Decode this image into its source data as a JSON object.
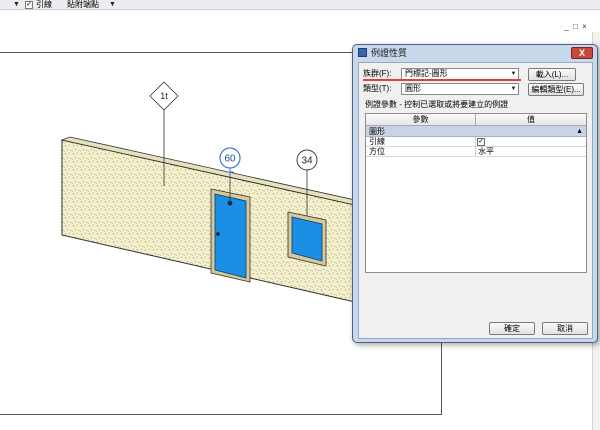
{
  "option_bar": {
    "leader_label": "引線",
    "leader_checked": true,
    "attachment_value": "貼附端點"
  },
  "view_tags": {
    "section_tag": "1t",
    "door_tag": "60",
    "window_tag": "34"
  },
  "colors": {
    "door_fill": "#1a8fe3",
    "window_fill": "#1a8fe3",
    "wall_fill": "#f4f0cc",
    "accent_red": "#d7453a"
  },
  "dialog": {
    "title": "例證性質",
    "close_glyph": "X",
    "family_label": "族群(F):",
    "family_value": "門標記-圓形",
    "load_button": "載入(L)...",
    "type_label": "類型(T):",
    "type_value": "圓形",
    "edit_type_button": "編輯類型(E)...",
    "instruction": "例證參數 - 控制已選取或將要建立的例證",
    "grid": {
      "col_param": "參數",
      "col_value": "值",
      "group": "圖形",
      "rows": [
        {
          "param": "引線",
          "value": "",
          "checkbox": true
        },
        {
          "param": "方位",
          "value": "水平",
          "checkbox": false
        }
      ]
    },
    "ok_button": "確定",
    "cancel_button": "取消"
  },
  "view_controls": {
    "minimize": "_",
    "restore": "□",
    "close": "×"
  }
}
